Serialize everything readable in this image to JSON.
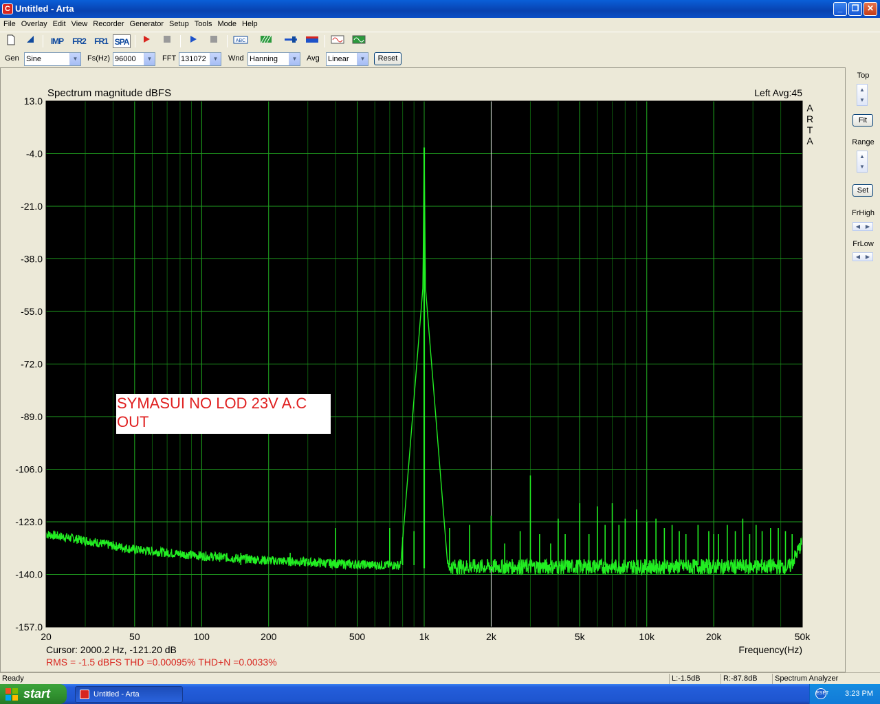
{
  "window": {
    "title": "Untitled - Arta",
    "icon": "C",
    "minimize": "_",
    "maximize": "❐",
    "close": "✕"
  },
  "menu": [
    "File",
    "Overlay",
    "Edit",
    "View",
    "Recorder",
    "Generator",
    "Setup",
    "Tools",
    "Mode",
    "Help"
  ],
  "toolbar": {
    "imp": "IMP",
    "fr2": "FR2",
    "fr1": "FR1",
    "spa": "SPA",
    "abc": "ABC"
  },
  "controls": {
    "gen_label": "Gen",
    "gen_value": "Sine",
    "fs_label": "Fs(Hz)",
    "fs_value": "96000",
    "fft_label": "FFT",
    "fft_value": "131072",
    "wnd_label": "Wnd",
    "wnd_value": "Hanning",
    "avg_label": "Avg",
    "avg_value": "Linear",
    "reset_label": "Reset"
  },
  "side": {
    "top_label": "Top",
    "fit_label": "Fit",
    "range_label": "Range",
    "set_label": "Set",
    "frhigh_label": "FrHigh",
    "frlow_label": "FrLow"
  },
  "chart_data": {
    "type": "line",
    "title": "Spectrum magnitude dBFS",
    "channel_info": "Left  Avg:45",
    "watermark": "ARTA",
    "xlabel": "Frequency(Hz)",
    "xscale": "log",
    "xlim": [
      20,
      50000
    ],
    "ylim": [
      -157,
      13
    ],
    "yticks": [
      13.0,
      -4.0,
      -21.0,
      -38.0,
      -55.0,
      -72.0,
      -89.0,
      -106.0,
      -123.0,
      -140.0,
      -157.0
    ],
    "ytick_labels": [
      "13.0",
      "-4.0",
      "-21.0",
      "-38.0",
      "-55.0",
      "-72.0",
      "-89.0",
      "-106.0",
      "-123.0",
      "-140.0",
      "-157.0"
    ],
    "xticks": [
      20,
      50,
      100,
      200,
      500,
      1000,
      2000,
      5000,
      10000,
      20000,
      50000
    ],
    "xtick_labels": [
      "20",
      "50",
      "100",
      "200",
      "500",
      "1k",
      "2k",
      "5k",
      "10k",
      "20k",
      "50k"
    ],
    "grid": true,
    "background": "#000000",
    "line_color": "#22ee22",
    "cursor_freq": 2000,
    "annotation": [
      "SYMASUI NO LOD 23V A.C",
      "OUT"
    ],
    "cursor_readout": "Cursor:  2000.2 Hz, -121.20 dB",
    "measurements": "RMS =   -1.5 dBFS   THD =0.00095%   THD+N =0.0033%",
    "series": [
      {
        "floor": [
          [
            20,
            -127
          ],
          [
            30,
            -129
          ],
          [
            50,
            -132
          ],
          [
            100,
            -134
          ],
          [
            200,
            -135.5
          ],
          [
            400,
            -136.5
          ],
          [
            600,
            -137
          ],
          [
            850,
            -137
          ]
        ],
        "fundamental": {
          "freq": 1000,
          "level": -2
        },
        "harmonics": [
          [
            150,
            -133
          ],
          [
            250,
            -133
          ],
          [
            400,
            -125
          ],
          [
            700,
            -125
          ],
          [
            800,
            -128
          ],
          [
            900,
            -126
          ],
          [
            1300,
            -125
          ],
          [
            1600,
            -124
          ],
          [
            2000,
            -121
          ],
          [
            2300,
            -130
          ],
          [
            2700,
            -126
          ],
          [
            3000,
            -108
          ],
          [
            3300,
            -127
          ],
          [
            3700,
            -130
          ],
          [
            4000,
            -122
          ],
          [
            4300,
            -127
          ],
          [
            5000,
            -117
          ],
          [
            5500,
            -127
          ],
          [
            6000,
            -118
          ],
          [
            6500,
            -124
          ],
          [
            7000,
            -117
          ],
          [
            7500,
            -124
          ],
          [
            8000,
            -122
          ],
          [
            9000,
            -119
          ],
          [
            10000,
            -123
          ],
          [
            11000,
            -122
          ],
          [
            12000,
            -125
          ],
          [
            13000,
            -124
          ],
          [
            14000,
            -126
          ],
          [
            15000,
            -127
          ],
          [
            17000,
            -124
          ],
          [
            19000,
            -126
          ],
          [
            20000,
            -127
          ],
          [
            21000,
            -127
          ],
          [
            23000,
            -124
          ],
          [
            25000,
            -126
          ],
          [
            27000,
            -122
          ],
          [
            29000,
            -127
          ],
          [
            31000,
            -124
          ],
          [
            33000,
            -126
          ],
          [
            36000,
            -125
          ],
          [
            39000,
            -125
          ],
          [
            42000,
            -126
          ],
          [
            45000,
            -127
          ]
        ]
      }
    ]
  },
  "status": {
    "ready": "Ready",
    "left": "L:-1.5dB",
    "right": "R:-87.8dB",
    "mode": "Spectrum Analyzer"
  },
  "taskbar": {
    "start": "start",
    "task": "Untitled - Arta",
    "clock": "3:23 PM",
    "tray_icon_text": "ESET"
  }
}
